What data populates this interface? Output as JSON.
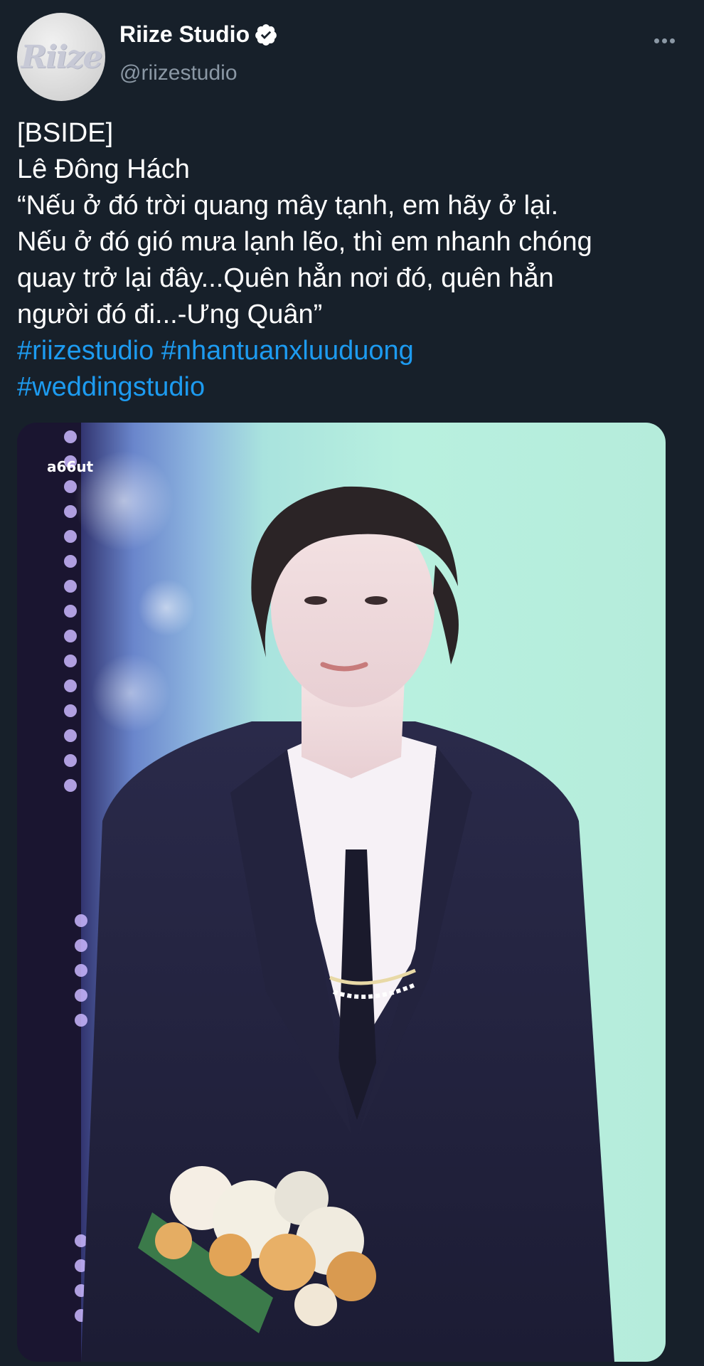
{
  "account": {
    "display_name": "Riize Studio",
    "handle": "@riizestudio",
    "avatar_text": "Riize",
    "verified": true
  },
  "tweet": {
    "lines": [
      "[BSIDE]",
      "Lê Đông Hách",
      "“Nếu ở đó trời quang mây tạnh, em hãy ở lại.",
      "Nếu ở đó gió mưa lạnh lẽo, thì em nhanh chóng",
      "quay trở lại đây...Quên hẳn nơi đó, quên hẳn",
      "người đó đi...-Ưng Quân”"
    ],
    "hashtags_line1": [
      "#riizestudio",
      "#nhantuanxluuduong"
    ],
    "hashtags_line2": [
      "#weddingstudio"
    ]
  },
  "media": {
    "watermark": "a66ut"
  },
  "colors": {
    "background": "#17202a",
    "text": "#ffffff",
    "secondary": "#8b98a5",
    "link": "#1d9bf0"
  },
  "icons": {
    "verified": "verified-badge-icon",
    "more": "more-options-icon"
  }
}
